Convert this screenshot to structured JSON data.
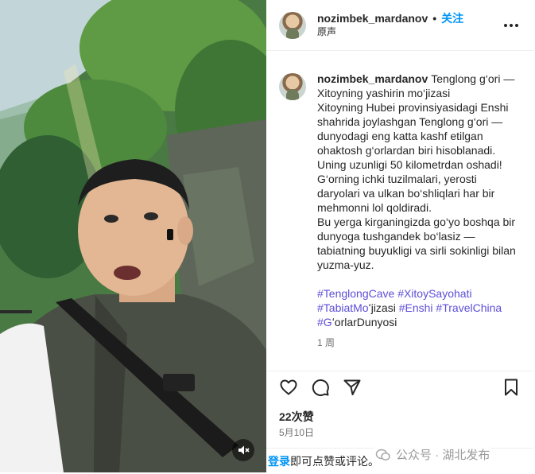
{
  "post": {
    "username": "nozimbek_mardanov",
    "follow_label": "关注",
    "audio_label": "原声",
    "caption_text": "Tenglong g‘ori — Xitoyning yashirin mo‘jizasi\nXitoyning Hubei provinsiyasidagi Enshi shahrida joylashgan Tenglong g‘ori — dunyodagi eng katta kashf etilgan ohaktosh g‘orlardan biri hisoblanadi. Uning uzunligi 50 kilometrdan oshadi! G‘orning ichki tuzilmalari, yerosti daryolari va ulkan bo‘shliqlari har bir mehmonni lol qoldiradi.\nBu yerga kirganingizda go‘yo boshqa bir dunyoga tushgandek bo‘lasiz — tabiatning buyukligi va sirli sokinligi bilan yuzma-yuz.",
    "hashtags": [
      "#TenglongCave",
      "#XitoySayohati",
      "#TabiatMo",
      "ʻjizasi",
      "#Enshi",
      "#TravelChina",
      "#G",
      "ʻorlarDunyosi"
    ],
    "time_ago": "1 周",
    "likes": "22次赞",
    "date": "5月10日",
    "login_link": "登录",
    "login_rest": "即可点赞或评论。"
  },
  "icons": {
    "like": "heart-icon",
    "comment": "comment-icon",
    "share": "send-icon",
    "save": "bookmark-icon",
    "more": "more-icon",
    "mute": "muted-speaker-icon"
  },
  "watermark": {
    "text": "公众号 · 湖北发布"
  },
  "colors": {
    "follow": "#0095f6",
    "hashtag": "#5c4fd6",
    "secondary_text": "#737373"
  }
}
